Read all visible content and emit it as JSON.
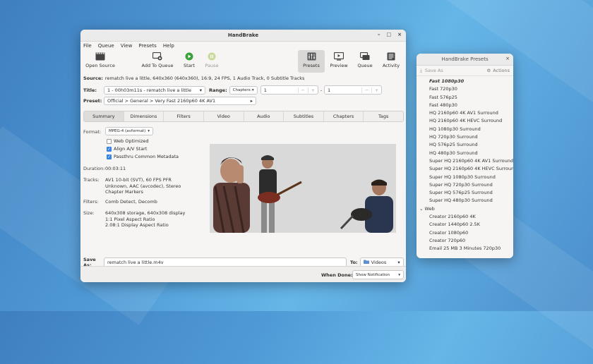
{
  "main": {
    "title": "HandBrake",
    "controls": {
      "minimize": "–",
      "maximize": "□",
      "close": "×"
    },
    "menu": [
      "File",
      "Queue",
      "View",
      "Presets",
      "Help"
    ],
    "toolbar": {
      "open_source": "Open Source",
      "add_to_queue": "Add To Queue",
      "start": "Start",
      "pause": "Pause",
      "presets": "Presets",
      "preview": "Preview",
      "queue": "Queue",
      "activity": "Activity"
    },
    "source_label": "Source:",
    "source_value": "rematch live a little, 640x360 (640x360), 16:9, 24 FPS, 1 Audio Track, 0 Subtitle Tracks",
    "title_label": "Title:",
    "title_value": "1 - 00h03m11s - rematch live a little",
    "range_label": "Range:",
    "range_mode": "Chapters:",
    "range_start": "1",
    "range_dash": "-",
    "range_end": "1",
    "spin_minus": "−",
    "spin_plus": "+",
    "preset_label": "Preset:",
    "preset_value": "Official > General > Very Fast 2160p60 4K AV1",
    "tabs": [
      "Summary",
      "Dimensions",
      "Filters",
      "Video",
      "Audio",
      "Subtitles",
      "Chapters",
      "Tags"
    ],
    "format_label": "Format:",
    "format_value": "MPEG-4 (avformat)",
    "web_optimized": "Web Optimized",
    "align_av": "Align A/V Start",
    "passthru": "Passthru Common Metadata",
    "duration_label": "Duration:",
    "duration_value": "00:03:11",
    "tracks_label": "Tracks:",
    "tracks_lines": [
      "AV1 10-bit (SVT), 60 FPS PFR",
      "Unknown, AAC (avcodec), Stereo",
      "Chapter Markers"
    ],
    "filters_label": "Filters:",
    "filters_value": "Comb Detect, Decomb",
    "size_label": "Size:",
    "size_lines": [
      "640x308 storage, 640x308 display",
      "1:1 Pixel Aspect Ratio",
      "2.08:1 Display Aspect Ratio"
    ],
    "save_as_label": "Save As:",
    "save_as_value": "rematch live a little.m4v",
    "to_label": "To:",
    "to_value": "Videos",
    "when_done_label": "When Done:",
    "when_done_value": "Show Notification"
  },
  "presets": {
    "title": "HandBrake Presets",
    "close": "×",
    "save_as": "Save As",
    "actions": "Actions",
    "items": [
      "Fast 1080p30",
      "Fast 720p30",
      "Fast 576p25",
      "Fast 480p30",
      "HQ 2160p60 4K AV1 Surround",
      "HQ 2160p60 4K HEVC Surround",
      "HQ 1080p30 Surround",
      "HQ 720p30 Surround",
      "HQ 576p25 Surround",
      "HQ 480p30 Surround",
      "Super HQ 2160p60 4K AV1 Surround",
      "Super HQ 2160p60 4K HEVC Surround",
      "Super HQ 1080p30 Surround",
      "Super HQ 720p30 Surround",
      "Super HQ 576p25 Surround",
      "Super HQ 480p30 Surround"
    ],
    "group": "Web",
    "group_items": [
      "Creator 2160p60 4K",
      "Creator 1440p60 2.5K",
      "Creator 1080p60",
      "Creator 720p60",
      "Email 25 MB 3 Minutes 720p30"
    ]
  },
  "colors": {
    "accent": "#3584e4",
    "start_green": "#3aa13a"
  }
}
